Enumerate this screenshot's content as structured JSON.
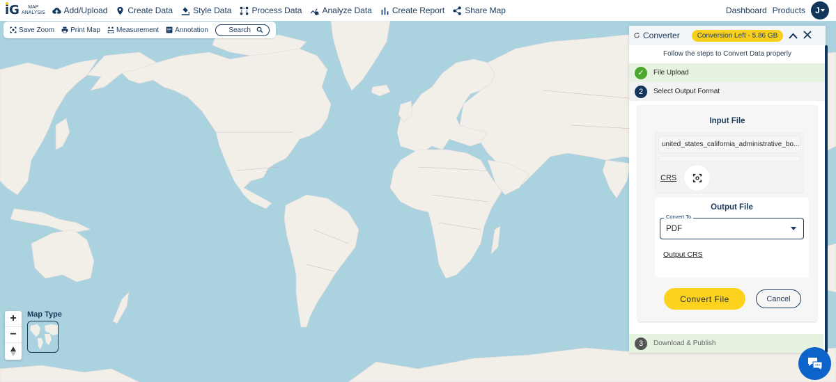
{
  "app": {
    "logo_mark": "iG",
    "logo_line1": "MAP",
    "logo_line2": "ANALYSIS"
  },
  "nav": {
    "items": [
      {
        "label": "Add/Upload",
        "icon": "cloud-upload-icon"
      },
      {
        "label": "Create Data",
        "icon": "map-pin-icon"
      },
      {
        "label": "Style Data",
        "icon": "paint-bucket-icon"
      },
      {
        "label": "Process Data",
        "icon": "process-icon"
      },
      {
        "label": "Analyze Data",
        "icon": "analyze-icon"
      },
      {
        "label": "Create Report",
        "icon": "bar-chart-icon"
      },
      {
        "label": "Share Map",
        "icon": "share-icon"
      }
    ],
    "dashboard": "Dashboard",
    "products": "Products",
    "avatar_initial": "J"
  },
  "toolbar": {
    "save_zoom": "Save Zoom",
    "print_map": "Print Map",
    "measurement": "Measurement",
    "annotation": "Annotation",
    "search_placeholder": "Search"
  },
  "map": {
    "zoom_in": "+",
    "zoom_out": "−",
    "map_type_label": "Map Type",
    "colors": {
      "water": "#aad3df",
      "land": "#f2efe9",
      "border": "#c9a7b6"
    }
  },
  "converter": {
    "title": "Converter",
    "badge": "Conversion Left - 5.86 GB",
    "subtitle": "Follow the steps to Convert Data properly",
    "steps": [
      {
        "num": "✓",
        "label": "File Upload",
        "state": "done"
      },
      {
        "num": "2",
        "label": "Select Output Format",
        "state": "active"
      },
      {
        "num": "3",
        "label": "Download & Publish",
        "state": "pending"
      }
    ],
    "input_file": {
      "heading": "Input File",
      "filename": "united_states_california_administrative_bo...",
      "crs_label": "CRS"
    },
    "output_file": {
      "heading": "Output File",
      "convert_to_label": "Convert To",
      "convert_to_value": "PDF",
      "output_crs_label": "Output CRS"
    },
    "convert_button": "Convert File",
    "cancel_button": "Cancel",
    "colors": {
      "accent": "#fdd21f",
      "primary": "#12355b",
      "success": "#4ba82e"
    }
  }
}
